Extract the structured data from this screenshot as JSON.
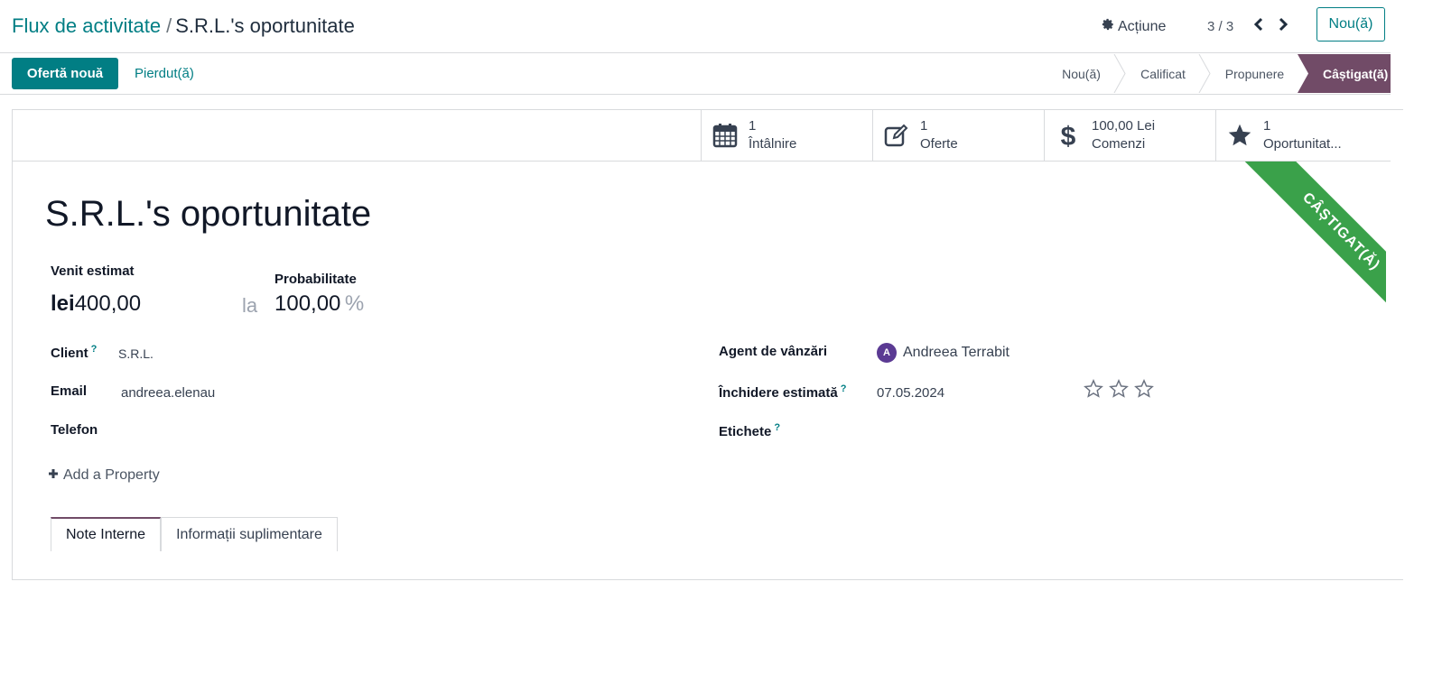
{
  "breadcrumb": {
    "parent": "Flux de activitate",
    "separator": "/",
    "current": "S.R.L.'s oportunitate"
  },
  "toolbar": {
    "action_label": "Acțiune",
    "pager": "3 / 3",
    "new_label": "Nou(ă)"
  },
  "statusbar": {
    "primary_label": "Ofertă nouă",
    "lost_label": "Pierdut(ă)",
    "stages": [
      "Nou(ă)",
      "Calificat",
      "Propunere",
      "Câștigat(ă)"
    ],
    "active_stage": "Câștigat(ă)",
    "active_color": "#714b67"
  },
  "smart_buttons": [
    {
      "icon": "calendar-icon",
      "value": "1",
      "label": "Întâlnire"
    },
    {
      "icon": "edit-icon",
      "value": "1",
      "label": "Oferte"
    },
    {
      "icon": "dollar-icon",
      "value": "100,00 Lei",
      "label": "Comenzi"
    },
    {
      "icon": "star-icon",
      "value": "1",
      "label": "Oportunitat..."
    }
  ],
  "ribbon": {
    "text": "CÂȘTIGAT(Ă)",
    "color": "#3aa14a"
  },
  "record": {
    "title": "S.R.L.'s oportunitate",
    "revenue_label": "Venit estimat",
    "currency": "lei",
    "revenue": "400,00",
    "at_label": "la",
    "probability_label": "Probabilitate",
    "probability": "100,00",
    "percent": "%"
  },
  "fields_left": {
    "client_label": "Client",
    "client_value": "S.R.L.",
    "email_label": "Email",
    "email_value": "andreea.elenau",
    "phone_label": "Telefon",
    "phone_value": "",
    "add_property": "Add a Property"
  },
  "fields_right": {
    "agent_label": "Agent de vânzări",
    "agent_initial": "A",
    "agent_value": "Andreea Terrabit",
    "close_label": "Închidere estimată",
    "close_value": "07.05.2024",
    "priority_stars": 0,
    "tags_label": "Etichete"
  },
  "help_mark": "?",
  "tabs": [
    "Note Interne",
    "Informații suplimentare"
  ],
  "colors": {
    "primary": "#017e84",
    "accent": "#714b67"
  }
}
